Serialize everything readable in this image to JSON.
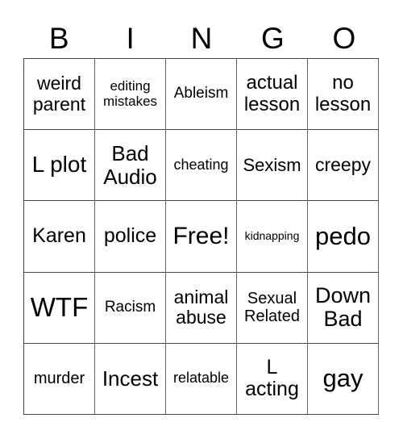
{
  "header": {
    "letters": [
      "B",
      "I",
      "N",
      "G",
      "O"
    ]
  },
  "card": {
    "rows": [
      [
        {
          "text": "weird parent"
        },
        {
          "text": "editing mistakes"
        },
        {
          "text": "Ableism"
        },
        {
          "text": "actual lesson"
        },
        {
          "text": "no lesson"
        }
      ],
      [
        {
          "text": "L plot"
        },
        {
          "text": "Bad Audio"
        },
        {
          "text": "cheating"
        },
        {
          "text": "Sexism"
        },
        {
          "text": "creepy"
        }
      ],
      [
        {
          "text": "Karen"
        },
        {
          "text": "police"
        },
        {
          "text": "Free!"
        },
        {
          "text": "kidnapping"
        },
        {
          "text": "pedo"
        }
      ],
      [
        {
          "text": "WTF"
        },
        {
          "text": "Racism"
        },
        {
          "text": "animal abuse"
        },
        {
          "text": "Sexual Related"
        },
        {
          "text": "Down Bad"
        }
      ],
      [
        {
          "text": "murder"
        },
        {
          "text": "Incest"
        },
        {
          "text": "relatable"
        },
        {
          "text": "L acting"
        },
        {
          "text": "gay"
        }
      ]
    ]
  }
}
